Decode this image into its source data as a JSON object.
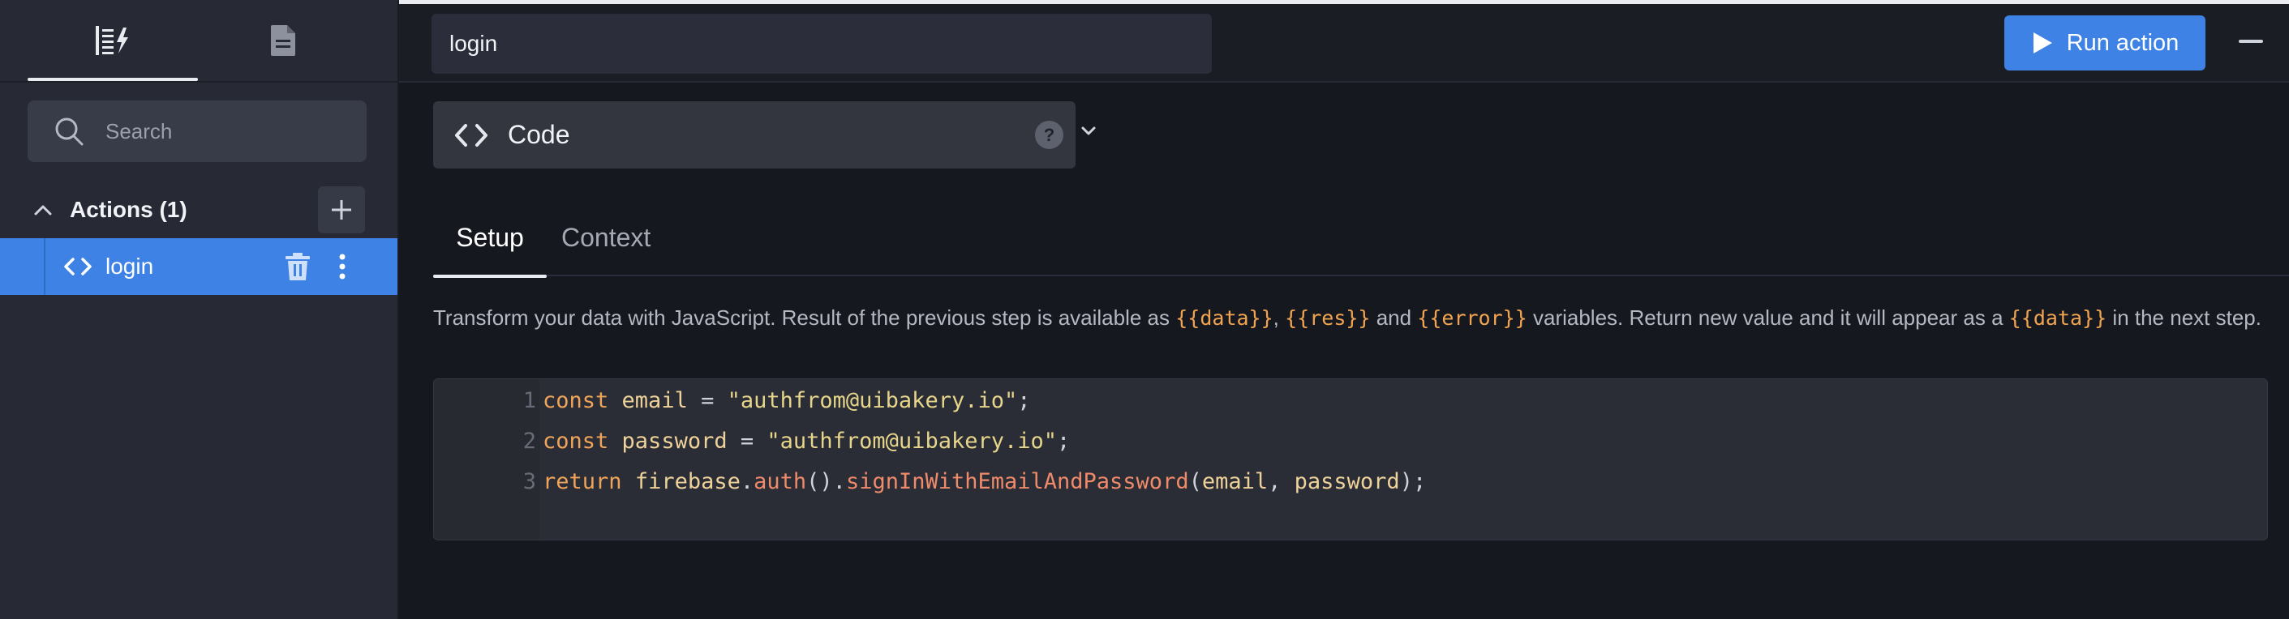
{
  "sidebar": {
    "tabs": [
      {
        "icon": "actions-list-icon"
      },
      {
        "icon": "document-icon"
      }
    ],
    "search": {
      "placeholder": "Search"
    },
    "actions_section": {
      "title": "Actions (1)"
    },
    "actions": [
      {
        "label": "login",
        "icon": "code-icon"
      }
    ]
  },
  "header": {
    "action_name": "login",
    "run_label": "Run action"
  },
  "step": {
    "type_label": "Code",
    "help": "?"
  },
  "tabs": [
    {
      "label": "Setup"
    },
    {
      "label": "Context"
    }
  ],
  "description": {
    "part1": "Transform your data with JavaScript. Result of the previous step is available as ",
    "var_data": "{{data}}",
    "sep1": ", ",
    "var_res": "{{res}}",
    "sep2": " and ",
    "var_error": "{{error}}",
    "part2": " variables. Return new value and it will appear as a ",
    "var_data2": "{{data}}",
    "part3": " in the next step."
  },
  "editor": {
    "line_numbers": [
      "1",
      "2",
      "3"
    ],
    "lines": [
      {
        "kw": "const",
        "var": "email",
        "op": " = ",
        "str": "\"authfrom@uibakery.io\"",
        "end": ";"
      },
      {
        "kw": "const",
        "var": "password",
        "op": " = ",
        "str": "\"authfrom@uibakery.io\"",
        "end": ";"
      },
      {
        "kw": "return",
        "obj": "firebase",
        "dot1": ".",
        "fn1": "auth",
        "paren": "().",
        "fn2": "signInWithEmailAndPassword",
        "open": "(",
        "a1": "email",
        "comma": ", ",
        "a2": "password",
        "close": ");"
      }
    ]
  },
  "colors": {
    "accent": "#3d82e4",
    "background": "#16181f",
    "sidebar": "#272a35",
    "code_highlight": "#f0a450"
  }
}
